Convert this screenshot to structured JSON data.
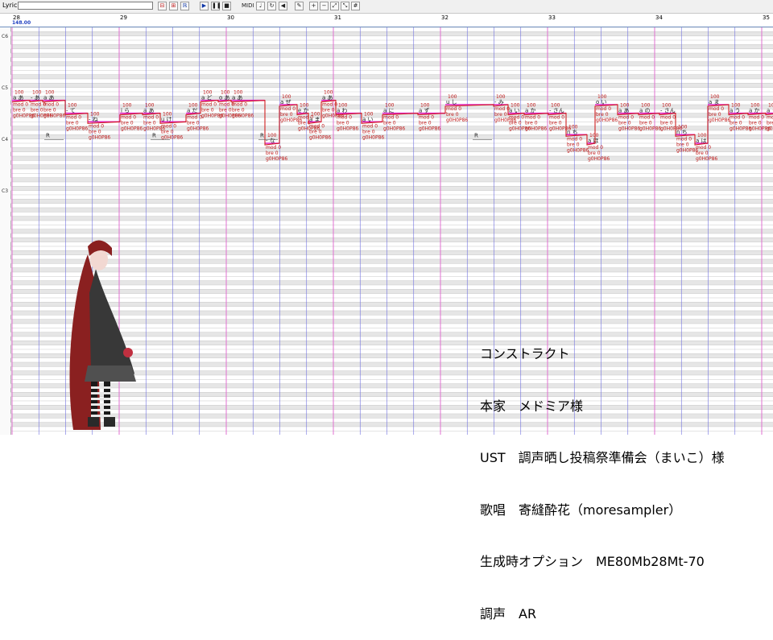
{
  "toolbar": {
    "lyric_label": "Lyric",
    "lyric_value": "",
    "midi_label": "MIDI"
  },
  "ruler": {
    "measures": [
      "28",
      "29",
      "30",
      "31",
      "32",
      "33",
      "34",
      "35"
    ],
    "tempo": "148.00"
  },
  "piano": {
    "octaves": [
      "C6",
      "C5",
      "C4",
      "C3"
    ]
  },
  "notes": [
    {
      "lyric": "a あ",
      "vel": "100",
      "pit": "69"
    },
    {
      "lyric": "- あ",
      "vel": "100",
      "pit": "69"
    },
    {
      "lyric": "a あ",
      "vel": "100",
      "pit": "69"
    },
    {
      "lyric": "- て",
      "vel": "100",
      "pit": "66"
    },
    {
      "lyric": "- ね",
      "vel": "100",
      "pit": "64"
    },
    {
      "lyric": "i ら",
      "vel": "100",
      "pit": "66"
    },
    {
      "lyric": "a あ",
      "vel": "100",
      "pit": "66"
    },
    {
      "lyric": "u け",
      "vel": "100",
      "pit": "64"
    },
    {
      "lyric": "a だ",
      "vel": "100",
      "pit": "66"
    },
    {
      "lyric": "a ど",
      "vel": "100",
      "pit": "69"
    },
    {
      "lyric": "o あ",
      "vel": "100",
      "pit": "69"
    },
    {
      "lyric": "a あ",
      "vel": "100",
      "pit": "69"
    },
    {
      "lyric": "- な",
      "vel": "100",
      "pit": "59"
    },
    {
      "lyric": "a ぜ",
      "vel": "100",
      "pit": "68"
    },
    {
      "lyric": "e か",
      "vel": "100",
      "pit": "66"
    },
    {
      "lyric": "a ま",
      "vel": "100",
      "pit": "64"
    },
    {
      "lyric": "a あ",
      "vel": "100",
      "pit": "69"
    },
    {
      "lyric": "a わ",
      "vel": "100",
      "pit": "66"
    },
    {
      "lyric": "a い",
      "vel": "100",
      "pit": "64"
    },
    {
      "lyric": "a に",
      "vel": "100",
      "pit": "66"
    },
    {
      "lyric": "a ず",
      "vel": "100",
      "pit": "66"
    },
    {
      "lyric": "u し",
      "vel": "100",
      "pit": "68"
    },
    {
      "lyric": "- み",
      "vel": "100",
      "pit": "68"
    },
    {
      "lyric": "a い",
      "vel": "100",
      "pit": "66"
    },
    {
      "lyric": "a か",
      "vel": "100",
      "pit": "66"
    },
    {
      "lyric": "- さん",
      "vel": "100",
      "pit": "66"
    },
    {
      "lyric": "n ち",
      "vel": "100",
      "pit": "61"
    },
    {
      "lyric": "a ほ",
      "vel": "100",
      "pit": "59"
    },
    {
      "lyric": "o い",
      "vel": "100",
      "pit": "68"
    },
    {
      "lyric": "a あ",
      "vel": "100",
      "pit": "66"
    },
    {
      "lyric": "a の",
      "vel": "100",
      "pit": "66"
    },
    {
      "lyric": "- さん",
      "vel": "100",
      "pit": "66"
    },
    {
      "lyric": "n ち",
      "vel": "100",
      "pit": "61"
    },
    {
      "lyric": "a は",
      "vel": "100",
      "pit": "59"
    },
    {
      "lyric": "a ま",
      "vel": "100",
      "pit": "68"
    },
    {
      "lyric": "a う",
      "vel": "100",
      "pit": "66"
    },
    {
      "lyric": "a か",
      "vel": "100",
      "pit": "66"
    },
    {
      "lyric": "a う",
      "vel": "100",
      "pit": "66"
    }
  ],
  "note_params": {
    "mod": "mod 0",
    "bre": "bre 0",
    "gen": "g0H0P86"
  },
  "rests": [
    "R",
    "R",
    "R",
    "R"
  ],
  "colors": {
    "grid_line": "#c8c8c8",
    "measure_line": "#e070d0",
    "beat_line": "#7070e0",
    "black_key_row": "#e6e6e6",
    "note_bar": "#e020c0",
    "pitch_curve": "#d02020",
    "note_text": "#c01818"
  },
  "credits": [
    "コンストラクト",
    "本家　メドミア様",
    "UST　調声晒し投稿祭準備会（まいこ）様",
    "歌唱　寄縫酔花（moresampler）",
    "生成時オプション　ME80Mb28Mt-70",
    "調声　AR"
  ]
}
